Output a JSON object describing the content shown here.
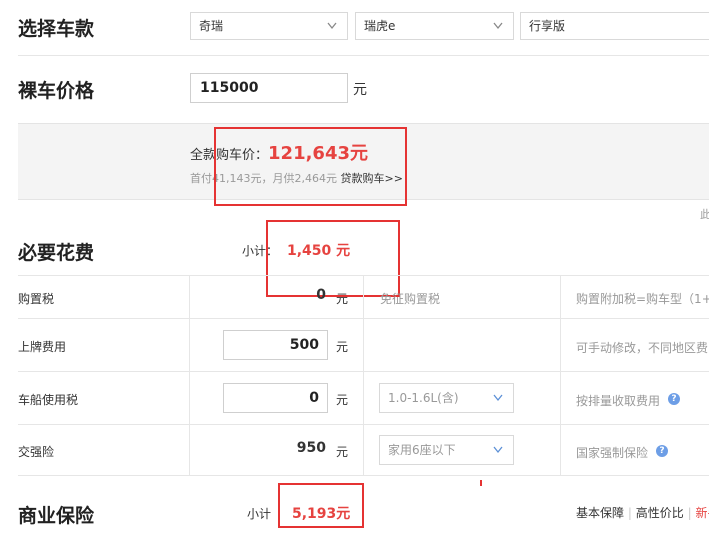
{
  "select_car": {
    "title": "选择车款",
    "brand": "奇瑞",
    "model": "瑞虎e",
    "trim": "行享版"
  },
  "bare_price": {
    "title": "裸车价格",
    "value": "115000",
    "unit": "元"
  },
  "summary": {
    "total_label": "全款购车价：",
    "total_value": "121,643元",
    "loan_text": "首付41,143元，月供2,464元",
    "loan_link": "贷款购车>>",
    "side_fragment": "此"
  },
  "required": {
    "title": "必要花费",
    "subtotal_label": "小计：",
    "subtotal_value": "1,450 元",
    "rows": [
      {
        "name": "购置税",
        "value": "0",
        "unit": "元",
        "option": "免征购置税",
        "note": "购置附加税=购车型（1+"
      },
      {
        "name": "上牌费用",
        "value": "500",
        "unit": "元",
        "option": "",
        "note": "可手动修改，不同地区费"
      },
      {
        "name": "车船使用税",
        "value": "0",
        "unit": "元",
        "option": "1.0-1.6L(含)",
        "note": "按排量收取费用"
      },
      {
        "name": "交强险",
        "value": "950",
        "unit": "元",
        "option": "家用6座以下",
        "note": "国家强制保险"
      }
    ]
  },
  "commercial": {
    "title": "商业保险",
    "subtotal_label": "小计",
    "subtotal_value": "5,193元",
    "options": [
      "基本保障",
      "高性价比",
      "新手"
    ],
    "divider": "|"
  },
  "colors": {
    "accent_red": "#e64340",
    "highlight_box": "#e53333",
    "help_icon": "#6d9ee6"
  }
}
